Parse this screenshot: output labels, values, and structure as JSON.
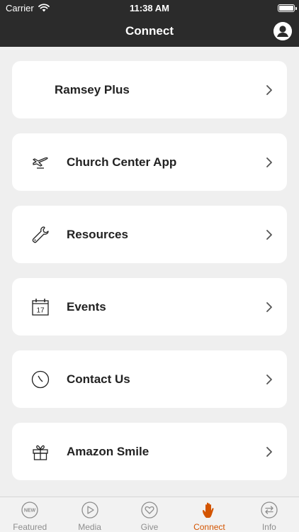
{
  "status": {
    "carrier": "Carrier",
    "time": "11:38 AM",
    "battery_level": 1.0
  },
  "nav": {
    "title": "Connect"
  },
  "cards": [
    {
      "label": "Ramsey Plus",
      "icon": "none"
    },
    {
      "label": "Church Center App",
      "icon": "airplane-icon"
    },
    {
      "label": "Resources",
      "icon": "wrench-icon"
    },
    {
      "label": "Events",
      "icon": "calendar-icon"
    },
    {
      "label": "Contact Us",
      "icon": "clock-icon"
    },
    {
      "label": "Amazon Smile",
      "icon": "gift-icon"
    }
  ],
  "calendar_icon_day": "17",
  "new_badge": "NEW",
  "tabs": [
    {
      "label": "Featured",
      "icon": "new-badge-icon",
      "active": false
    },
    {
      "label": "Media",
      "icon": "play-icon",
      "active": false
    },
    {
      "label": "Give",
      "icon": "heart-icon",
      "active": false
    },
    {
      "label": "Connect",
      "icon": "hand-icon",
      "active": true
    },
    {
      "label": "Info",
      "icon": "exchange-icon",
      "active": false
    }
  ],
  "colors": {
    "header": "#2b2b2b",
    "background": "#efefef",
    "active_tab": "#d35400",
    "inactive_tab": "#8e8e8e"
  }
}
